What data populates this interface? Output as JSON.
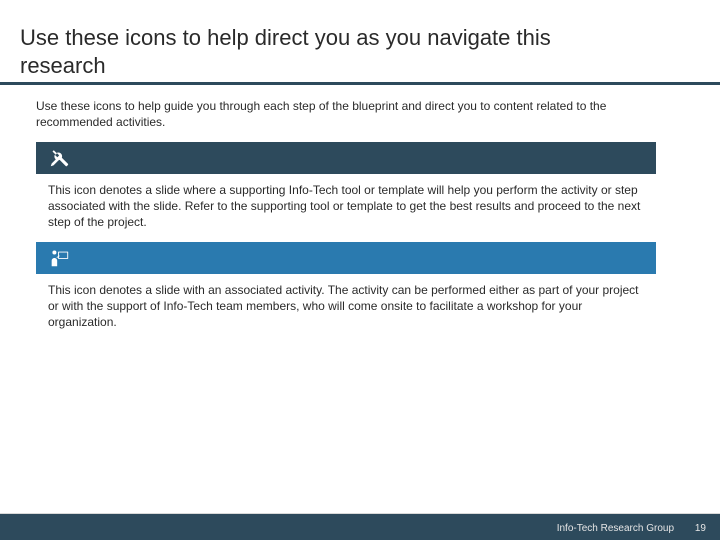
{
  "title": "Use these icons to help direct you as you navigate this research",
  "intro": "Use these icons to help guide you through each step of the blueprint and direct you to content related to the recommended activities.",
  "sections": [
    {
      "icon": "tools-icon",
      "description": "This icon denotes a slide where a supporting Info-Tech tool or template will help you perform the activity or step associated with the slide. Refer to the supporting tool or template to get the best results and proceed to the next step of the project."
    },
    {
      "icon": "teacher-icon",
      "description": "This icon denotes a slide with an associated activity. The activity can be performed either as part of your project or with the support of Info-Tech team members, who will come onsite to facilitate a workshop for your organization."
    }
  ],
  "footer": {
    "org": "Info-Tech Research Group",
    "page": "19"
  }
}
